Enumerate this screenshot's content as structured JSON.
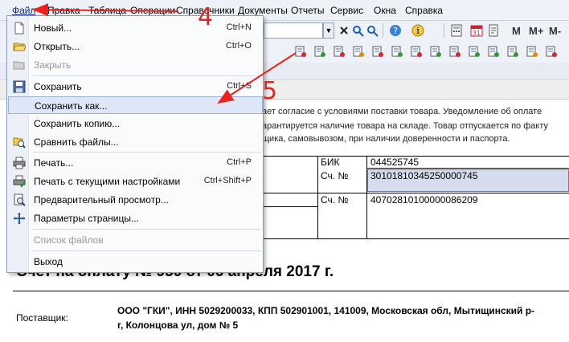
{
  "menubar": {
    "items": [
      "Файл",
      "Правка",
      "Таблица",
      "Операции",
      "Справочники",
      "Документы",
      "Отчеты",
      "Сервис",
      "Окна",
      "Справка"
    ]
  },
  "toolbar": {
    "text_buttons": [
      "M",
      "M+",
      "M-"
    ]
  },
  "file_menu": {
    "items": [
      {
        "label": "Новый...",
        "shortcut": "Ctrl+N",
        "icon": "new-document-icon",
        "state": "enabled"
      },
      {
        "label": "Открыть...",
        "shortcut": "Ctrl+O",
        "icon": "open-folder-icon",
        "state": "enabled"
      },
      {
        "label": "Закрыть",
        "shortcut": "",
        "icon": "close-folder-icon",
        "state": "disabled"
      },
      {
        "label": "Сохранить",
        "shortcut": "Ctrl+S",
        "icon": "save-icon",
        "state": "enabled"
      },
      {
        "label": "Сохранить как...",
        "shortcut": "",
        "icon": "",
        "state": "highlighted"
      },
      {
        "label": "Сохранить копию...",
        "shortcut": "",
        "icon": "",
        "state": "enabled"
      },
      {
        "label": "Сравнить файлы...",
        "shortcut": "",
        "icon": "compare-files-icon",
        "state": "enabled"
      },
      {
        "label": "Печать...",
        "shortcut": "Ctrl+P",
        "icon": "printer-icon",
        "state": "enabled"
      },
      {
        "label": "Печать с текущими настройками",
        "shortcut": "Ctrl+Shift+P",
        "icon": "quick-print-icon",
        "state": "enabled"
      },
      {
        "label": "Предварительный просмотр...",
        "shortcut": "",
        "icon": "print-preview-icon",
        "state": "enabled"
      },
      {
        "label": "Параметры страницы...",
        "shortcut": "",
        "icon": "page-setup-icon",
        "state": "enabled"
      },
      {
        "label": "Список файлов",
        "shortcut": "",
        "icon": "",
        "state": "disabled"
      },
      {
        "label": "Выход",
        "shortcut": "",
        "icon": "",
        "state": "enabled"
      }
    ]
  },
  "document": {
    "notice_lines": [
      "ает согласие с условиями поставки товара. Уведомление об оплате",
      "арантируется наличие товара на складе. Товар отпускается по факту",
      "щика, самовывозом, при наличии доверенности и паспорта."
    ],
    "bank": {
      "bik_label": "БИК",
      "bik_value": "044525745",
      "acct1_label": "Сч. №",
      "acct1_value": "30101810345250000745",
      "acct2_label": "Сч. №",
      "acct2_value": "40702810100000086209"
    },
    "invoice_title": "Счет на оплату № 950 от 06 апреля 2017 г.",
    "supplier_label": "Поставщик:",
    "supplier_line1": "ООО \"ГКИ\", ИНН 5029200033, КПП 502901001, 141009, Московская обл, Мытищинский р-",
    "supplier_line2": "г, Колонцова ул, дом № 5"
  },
  "annotations": {
    "step1": "4",
    "step2": "5",
    "color": "#e8231f"
  }
}
